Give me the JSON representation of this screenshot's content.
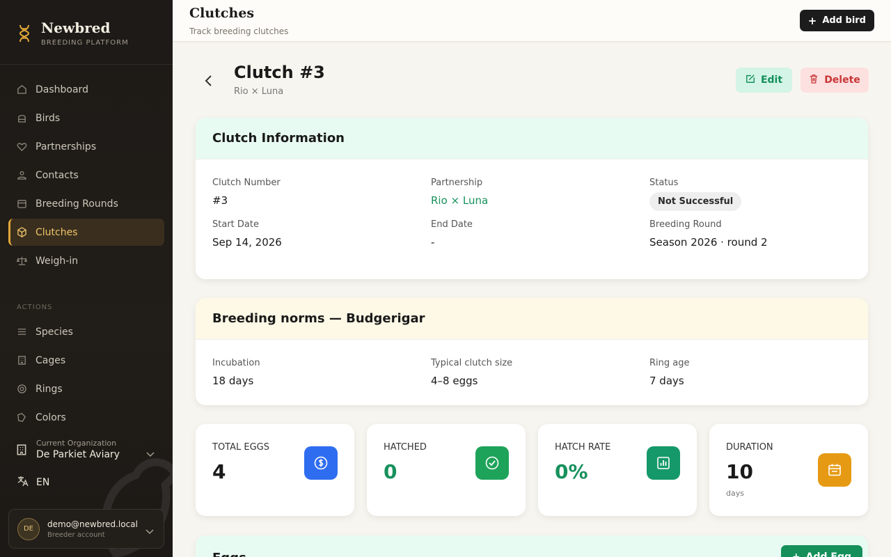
{
  "brand": {
    "name": "Newbred",
    "subtitle": "BREEDING PLATFORM"
  },
  "nav": {
    "items": [
      {
        "label": "Dashboard",
        "icon": "home-icon"
      },
      {
        "label": "Birds",
        "icon": "cage-icon"
      },
      {
        "label": "Partnerships",
        "icon": "heart-icon"
      },
      {
        "label": "Contacts",
        "icon": "contacts-icon"
      },
      {
        "label": "Breeding Rounds",
        "icon": "calendar-icon"
      },
      {
        "label": "Clutches",
        "icon": "box-icon",
        "active": true
      },
      {
        "label": "Weigh-in",
        "icon": "scale-icon"
      }
    ],
    "actions_label": "ACTIONS",
    "actions": [
      {
        "label": "Species",
        "icon": "list-icon"
      },
      {
        "label": "Cages",
        "icon": "building-icon"
      },
      {
        "label": "Rings",
        "icon": "ring-icon"
      },
      {
        "label": "Colors",
        "icon": "palette-icon"
      }
    ]
  },
  "org": {
    "label": "Current Organization",
    "name": "De Parkiet Aviary"
  },
  "language": "EN",
  "user": {
    "initials": "DE",
    "email": "demo@newbred.local",
    "role": "Breeder account"
  },
  "header": {
    "title": "Clutches",
    "subtitle": "Track breeding clutches",
    "add_bird": "Add bird"
  },
  "clutch": {
    "title": "Clutch #3",
    "subtitle": "Rio × Luna",
    "edit": "Edit",
    "delete": "Delete"
  },
  "info": {
    "title": "Clutch Information",
    "clutch_number_label": "Clutch Number",
    "clutch_number": "#3",
    "partnership_label": "Partnership",
    "partnership": "Rio × Luna",
    "status_label": "Status",
    "status": "Not Successful",
    "start_label": "Start Date",
    "start": "Sep 14, 2026",
    "end_label": "End Date",
    "end": "-",
    "round_label": "Breeding Round",
    "round": "Season 2026 · round 2"
  },
  "norms": {
    "title": "Breeding norms — Budgerigar",
    "incubation_label": "Incubation",
    "incubation": "18 days",
    "clutch_size_label": "Typical clutch size",
    "clutch_size": "4–8 eggs",
    "ring_age_label": "Ring age",
    "ring_age": "7 days"
  },
  "stats": {
    "total_label": "TOTAL EGGS",
    "total": "4",
    "hatched_label": "HATCHED",
    "hatched": "0",
    "rate_label": "HATCH RATE",
    "rate": "0%",
    "duration_label": "DURATION",
    "duration": "10",
    "duration_unit": "days"
  },
  "eggs": {
    "title": "Eggs",
    "add": "Add Egg"
  },
  "colors": {
    "accent": "#e2a83a",
    "green": "#17915c",
    "danger": "#c93535"
  }
}
